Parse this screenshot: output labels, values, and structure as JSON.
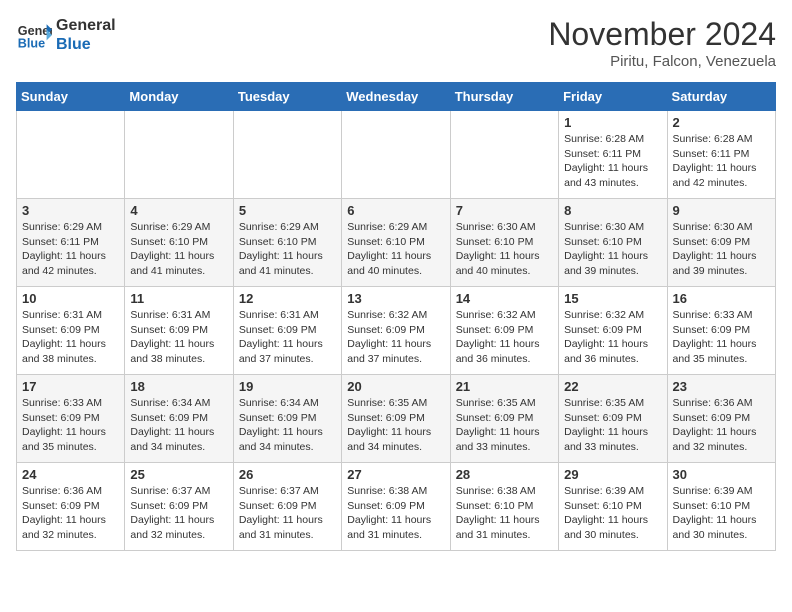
{
  "header": {
    "logo_line1": "General",
    "logo_line2": "Blue",
    "month": "November 2024",
    "location": "Piritu, Falcon, Venezuela"
  },
  "weekdays": [
    "Sunday",
    "Monday",
    "Tuesday",
    "Wednesday",
    "Thursday",
    "Friday",
    "Saturday"
  ],
  "weeks": [
    [
      {
        "day": "",
        "info": ""
      },
      {
        "day": "",
        "info": ""
      },
      {
        "day": "",
        "info": ""
      },
      {
        "day": "",
        "info": ""
      },
      {
        "day": "",
        "info": ""
      },
      {
        "day": "1",
        "info": "Sunrise: 6:28 AM\nSunset: 6:11 PM\nDaylight: 11 hours\nand 43 minutes."
      },
      {
        "day": "2",
        "info": "Sunrise: 6:28 AM\nSunset: 6:11 PM\nDaylight: 11 hours\nand 42 minutes."
      }
    ],
    [
      {
        "day": "3",
        "info": "Sunrise: 6:29 AM\nSunset: 6:11 PM\nDaylight: 11 hours\nand 42 minutes."
      },
      {
        "day": "4",
        "info": "Sunrise: 6:29 AM\nSunset: 6:10 PM\nDaylight: 11 hours\nand 41 minutes."
      },
      {
        "day": "5",
        "info": "Sunrise: 6:29 AM\nSunset: 6:10 PM\nDaylight: 11 hours\nand 41 minutes."
      },
      {
        "day": "6",
        "info": "Sunrise: 6:29 AM\nSunset: 6:10 PM\nDaylight: 11 hours\nand 40 minutes."
      },
      {
        "day": "7",
        "info": "Sunrise: 6:30 AM\nSunset: 6:10 PM\nDaylight: 11 hours\nand 40 minutes."
      },
      {
        "day": "8",
        "info": "Sunrise: 6:30 AM\nSunset: 6:10 PM\nDaylight: 11 hours\nand 39 minutes."
      },
      {
        "day": "9",
        "info": "Sunrise: 6:30 AM\nSunset: 6:09 PM\nDaylight: 11 hours\nand 39 minutes."
      }
    ],
    [
      {
        "day": "10",
        "info": "Sunrise: 6:31 AM\nSunset: 6:09 PM\nDaylight: 11 hours\nand 38 minutes."
      },
      {
        "day": "11",
        "info": "Sunrise: 6:31 AM\nSunset: 6:09 PM\nDaylight: 11 hours\nand 38 minutes."
      },
      {
        "day": "12",
        "info": "Sunrise: 6:31 AM\nSunset: 6:09 PM\nDaylight: 11 hours\nand 37 minutes."
      },
      {
        "day": "13",
        "info": "Sunrise: 6:32 AM\nSunset: 6:09 PM\nDaylight: 11 hours\nand 37 minutes."
      },
      {
        "day": "14",
        "info": "Sunrise: 6:32 AM\nSunset: 6:09 PM\nDaylight: 11 hours\nand 36 minutes."
      },
      {
        "day": "15",
        "info": "Sunrise: 6:32 AM\nSunset: 6:09 PM\nDaylight: 11 hours\nand 36 minutes."
      },
      {
        "day": "16",
        "info": "Sunrise: 6:33 AM\nSunset: 6:09 PM\nDaylight: 11 hours\nand 35 minutes."
      }
    ],
    [
      {
        "day": "17",
        "info": "Sunrise: 6:33 AM\nSunset: 6:09 PM\nDaylight: 11 hours\nand 35 minutes."
      },
      {
        "day": "18",
        "info": "Sunrise: 6:34 AM\nSunset: 6:09 PM\nDaylight: 11 hours\nand 34 minutes."
      },
      {
        "day": "19",
        "info": "Sunrise: 6:34 AM\nSunset: 6:09 PM\nDaylight: 11 hours\nand 34 minutes."
      },
      {
        "day": "20",
        "info": "Sunrise: 6:35 AM\nSunset: 6:09 PM\nDaylight: 11 hours\nand 34 minutes."
      },
      {
        "day": "21",
        "info": "Sunrise: 6:35 AM\nSunset: 6:09 PM\nDaylight: 11 hours\nand 33 minutes."
      },
      {
        "day": "22",
        "info": "Sunrise: 6:35 AM\nSunset: 6:09 PM\nDaylight: 11 hours\nand 33 minutes."
      },
      {
        "day": "23",
        "info": "Sunrise: 6:36 AM\nSunset: 6:09 PM\nDaylight: 11 hours\nand 32 minutes."
      }
    ],
    [
      {
        "day": "24",
        "info": "Sunrise: 6:36 AM\nSunset: 6:09 PM\nDaylight: 11 hours\nand 32 minutes."
      },
      {
        "day": "25",
        "info": "Sunrise: 6:37 AM\nSunset: 6:09 PM\nDaylight: 11 hours\nand 32 minutes."
      },
      {
        "day": "26",
        "info": "Sunrise: 6:37 AM\nSunset: 6:09 PM\nDaylight: 11 hours\nand 31 minutes."
      },
      {
        "day": "27",
        "info": "Sunrise: 6:38 AM\nSunset: 6:09 PM\nDaylight: 11 hours\nand 31 minutes."
      },
      {
        "day": "28",
        "info": "Sunrise: 6:38 AM\nSunset: 6:10 PM\nDaylight: 11 hours\nand 31 minutes."
      },
      {
        "day": "29",
        "info": "Sunrise: 6:39 AM\nSunset: 6:10 PM\nDaylight: 11 hours\nand 30 minutes."
      },
      {
        "day": "30",
        "info": "Sunrise: 6:39 AM\nSunset: 6:10 PM\nDaylight: 11 hours\nand 30 minutes."
      }
    ]
  ]
}
